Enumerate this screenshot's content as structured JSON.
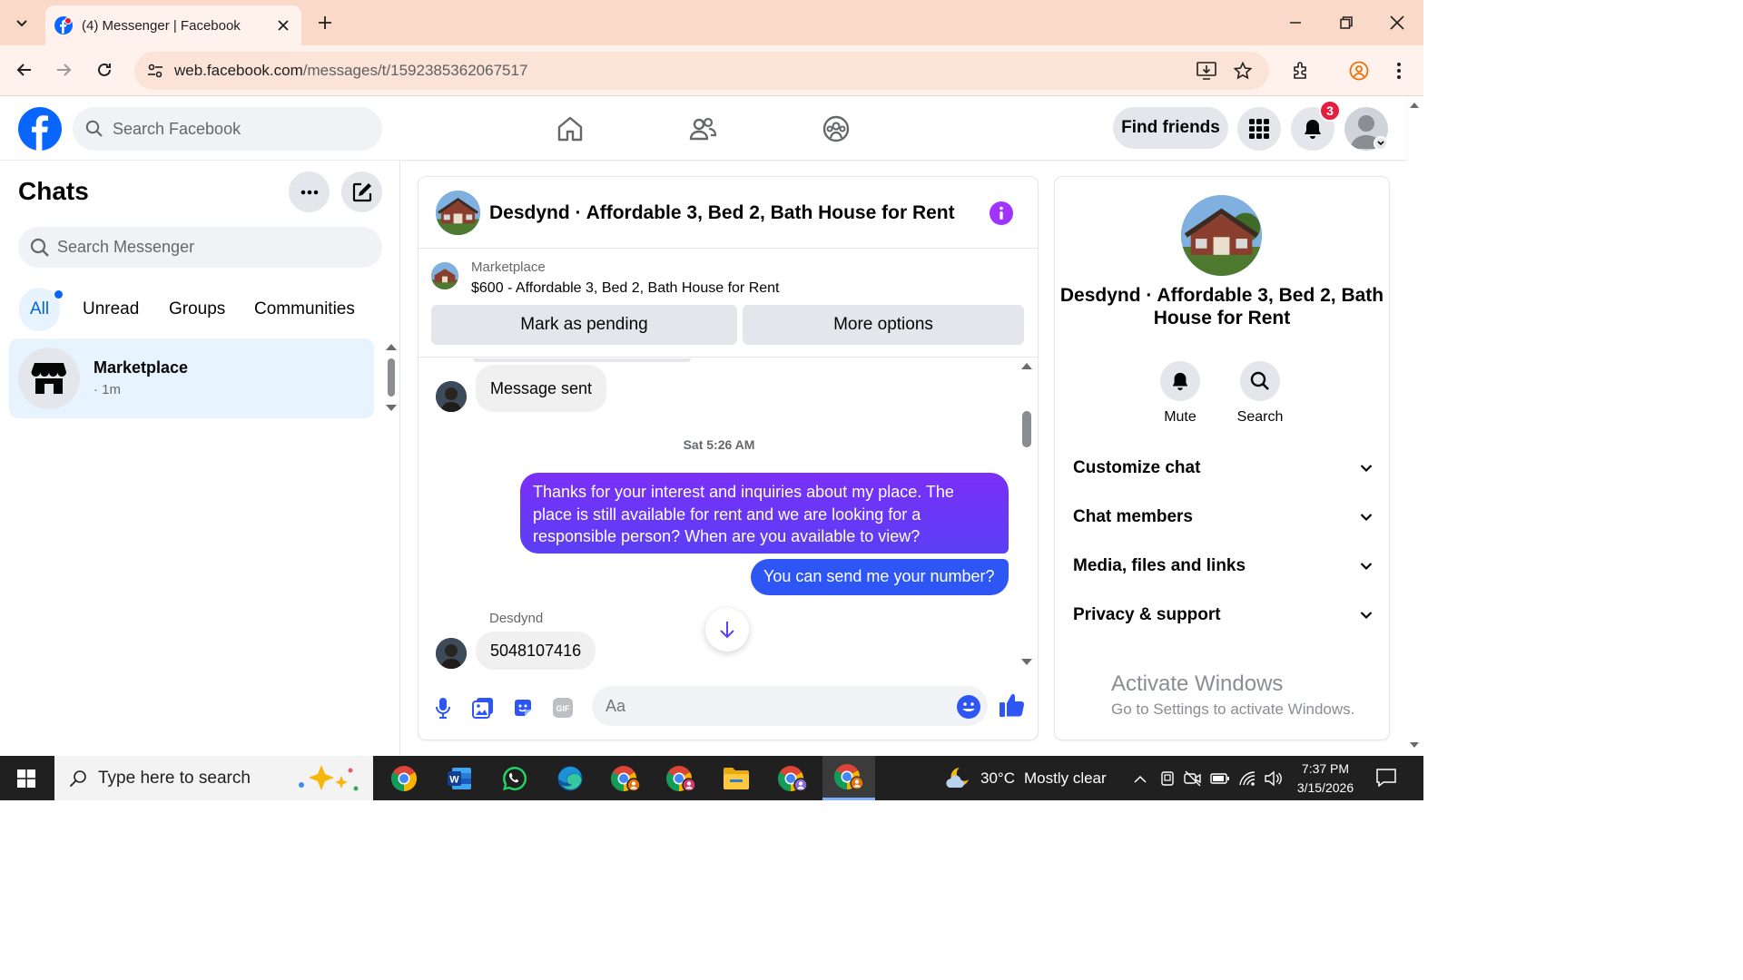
{
  "browser": {
    "tab": {
      "title": "(4) Messenger | Facebook"
    },
    "url": {
      "domain": "web.facebook.com",
      "path": "/messages/t/1592385362067517"
    }
  },
  "facebook": {
    "search_placeholder": "Search Facebook",
    "find_friends_label": "Find friends",
    "notification_count": "3"
  },
  "chats": {
    "title": "Chats",
    "search_placeholder": "Search Messenger",
    "filters": [
      {
        "label": "All",
        "active": true
      },
      {
        "label": "Unread"
      },
      {
        "label": "Groups"
      },
      {
        "label": "Communities"
      }
    ],
    "items": [
      {
        "name": "Marketplace",
        "time": "· 1m"
      }
    ]
  },
  "conversation": {
    "title": "Desdynd · Affordable 3, Bed 2, Bath House for Rent",
    "listing": {
      "label": "Marketplace",
      "price_title": "$600 - Affordable 3, Bed 2, Bath House for Rent",
      "mark_pending_label": "Mark as pending",
      "more_options_label": "More options"
    },
    "messages": {
      "msg1": "Message sent",
      "timestamp": "Sat 5:26 AM",
      "msg2": "Thanks for your interest and inquiries about my place. The place is still available for rent and we are looking for a responsible person? When are you available to view?",
      "msg3": "You can send me your number?",
      "sender": "Desdynd",
      "msg4": "5048107416"
    },
    "composer_placeholder": "Aa"
  },
  "info_panel": {
    "name": "Desdynd · Affordable 3, Bed 2, Bath House for Rent",
    "actions": [
      {
        "label": "Mute"
      },
      {
        "label": "Search"
      }
    ],
    "sections": [
      {
        "label": "Customize chat"
      },
      {
        "label": "Chat members"
      },
      {
        "label": "Media, files and links"
      },
      {
        "label": "Privacy & support"
      }
    ]
  },
  "watermark": {
    "line1": "Activate Windows",
    "line2": "Go to Settings to activate Windows."
  },
  "taskbar": {
    "search_placeholder": "Type here to search",
    "weather": {
      "temp": "30°C",
      "desc": "Mostly clear"
    },
    "time": "7:37 PM",
    "date": "3/15/2026"
  },
  "colors": {
    "fb_blue": "#0866ff",
    "outgoing_top": "#7b2ff7",
    "outgoing_bottom": "#2e56f4",
    "tabstrip": "#fbd9c9",
    "taskbar": "#202020"
  }
}
